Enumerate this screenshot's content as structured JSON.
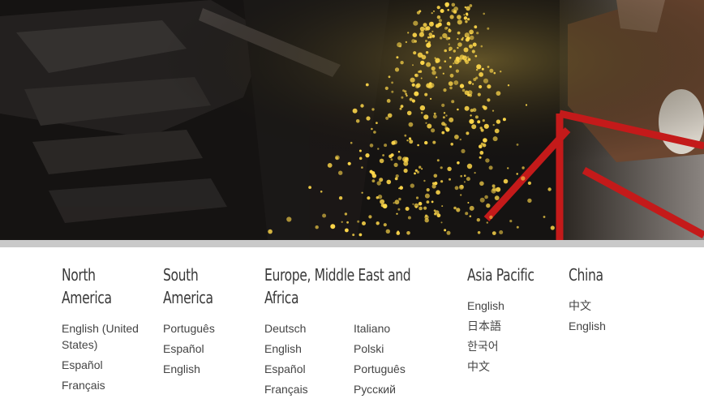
{
  "hero": {
    "description_icon": "welding-sparks-image"
  },
  "regions": [
    {
      "name": "North\nAmerica",
      "links": [
        "English (United States)",
        "Español",
        "Français"
      ]
    },
    {
      "name": "South\nAmerica",
      "links": [
        "Português",
        "Español",
        "English"
      ]
    },
    {
      "name": "Europe, Middle East and Africa",
      "links_left": [
        "Deutsch",
        "English",
        "Español",
        "Français"
      ],
      "links_right": [
        "Italiano",
        "Polski",
        "Português",
        "Русский"
      ]
    },
    {
      "name": "Asia Pacific",
      "links": [
        "English",
        "日本語",
        "한국어",
        "中文"
      ]
    },
    {
      "name": "China",
      "links": [
        "中文",
        "English"
      ]
    }
  ],
  "colors": {
    "heading": "#3a3a3a",
    "link": "#444444",
    "spark": "#ffd84a",
    "frame": "#c41a1a"
  }
}
